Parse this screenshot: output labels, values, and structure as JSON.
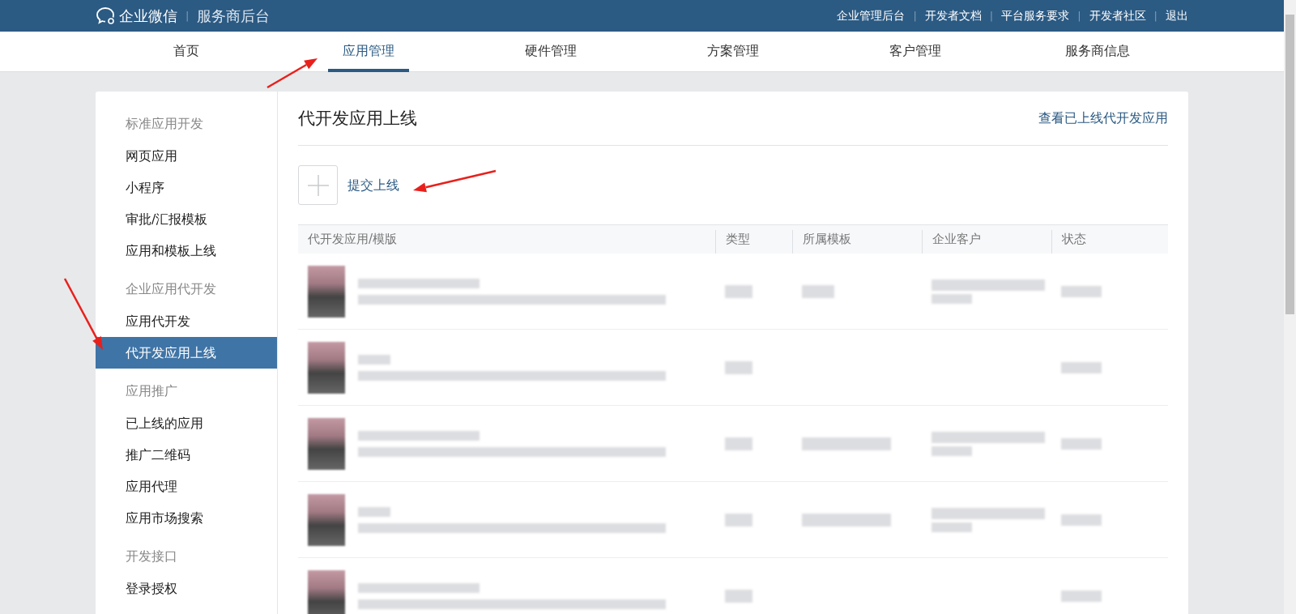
{
  "header": {
    "logo_text": "企业微信",
    "divider": "|",
    "subtitle": "服务商后台",
    "links": [
      "企业管理后台",
      "开发者文档",
      "平台服务要求",
      "开发者社区",
      "退出"
    ]
  },
  "nav": [
    {
      "label": "首页",
      "selected": false
    },
    {
      "label": "应用管理",
      "selected": true
    },
    {
      "label": "硬件管理",
      "selected": false
    },
    {
      "label": "方案管理",
      "selected": false
    },
    {
      "label": "客户管理",
      "selected": false
    },
    {
      "label": "服务商信息",
      "selected": false
    }
  ],
  "sidebar": [
    {
      "group": "标准应用开发",
      "items": [
        {
          "label": "网页应用",
          "selected": false
        },
        {
          "label": "小程序",
          "selected": false
        },
        {
          "label": "审批/汇报模板",
          "selected": false
        },
        {
          "label": "应用和模板上线",
          "selected": false
        }
      ]
    },
    {
      "group": "企业应用代开发",
      "items": [
        {
          "label": "应用代开发",
          "selected": false
        },
        {
          "label": "代开发应用上线",
          "selected": true
        }
      ]
    },
    {
      "group": "应用推广",
      "items": [
        {
          "label": "已上线的应用",
          "selected": false
        },
        {
          "label": "推广二维码",
          "selected": false
        },
        {
          "label": "应用代理",
          "selected": false
        },
        {
          "label": "应用市场搜索",
          "selected": false
        }
      ]
    },
    {
      "group": "开发接口",
      "items": [
        {
          "label": "登录授权",
          "selected": false
        }
      ]
    }
  ],
  "content": {
    "title": "代开发应用上线",
    "top_link": "查看已上线代开发应用",
    "add_label": "提交上线"
  },
  "table": {
    "columns": [
      "代开发应用/模版",
      "类型",
      "所属模板",
      "企业客户",
      "状态"
    ],
    "rows": [
      {
        "has_template": true,
        "has_customer": true
      },
      {
        "has_template": false,
        "has_customer": false
      },
      {
        "has_template": true,
        "has_customer": true
      },
      {
        "has_template": true,
        "has_customer": true
      },
      {
        "has_template": false,
        "has_customer": false
      }
    ]
  }
}
